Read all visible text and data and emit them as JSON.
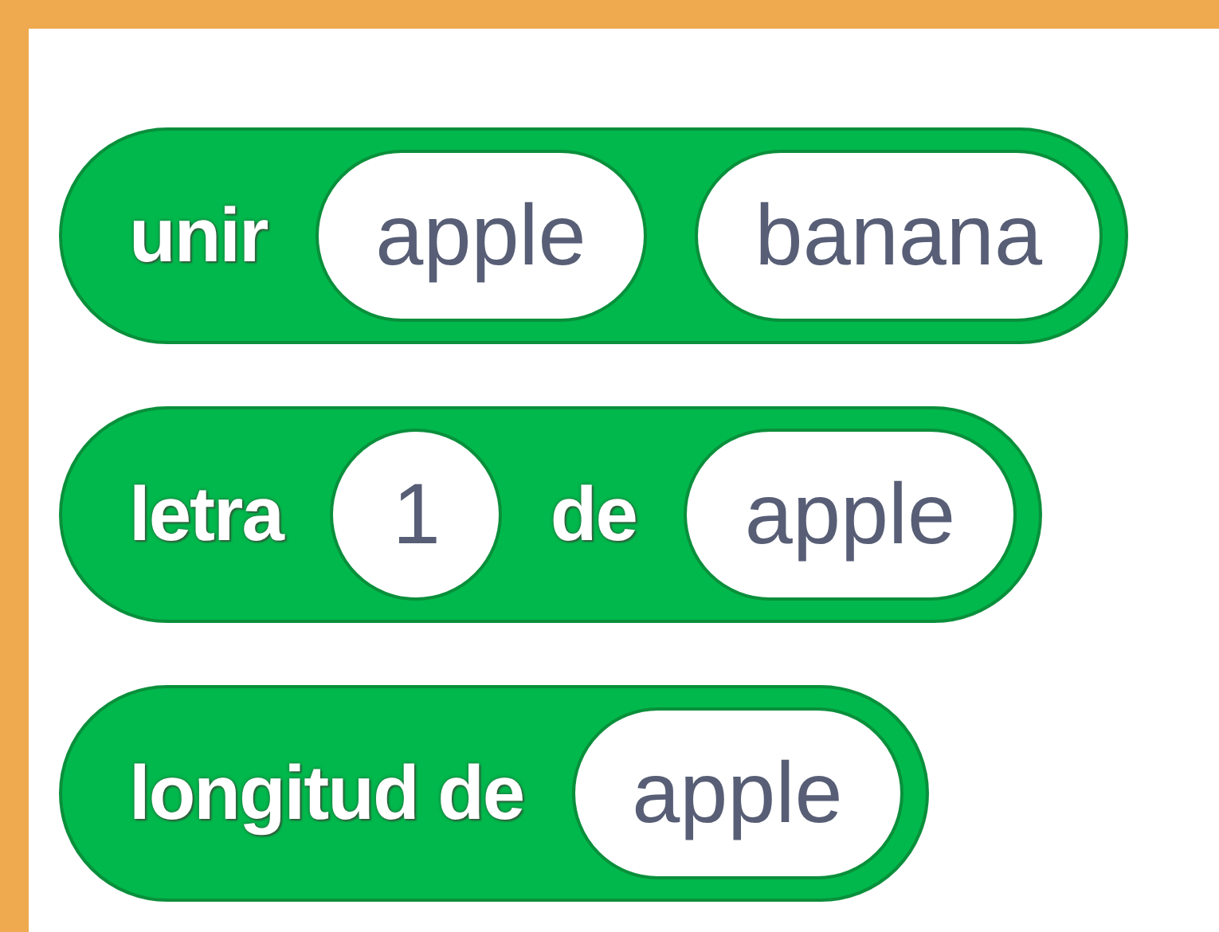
{
  "blocks": [
    {
      "parts": [
        {
          "kind": "label",
          "text": "unir"
        },
        {
          "kind": "input",
          "text": "apple"
        },
        {
          "kind": "input",
          "text": "banana"
        }
      ]
    },
    {
      "parts": [
        {
          "kind": "label",
          "text": "letra"
        },
        {
          "kind": "input",
          "text": "1"
        },
        {
          "kind": "label",
          "text": "de"
        },
        {
          "kind": "input",
          "text": "apple"
        }
      ]
    },
    {
      "parts": [
        {
          "kind": "label",
          "text": "longitud de"
        },
        {
          "kind": "input",
          "text": "apple"
        }
      ]
    }
  ]
}
